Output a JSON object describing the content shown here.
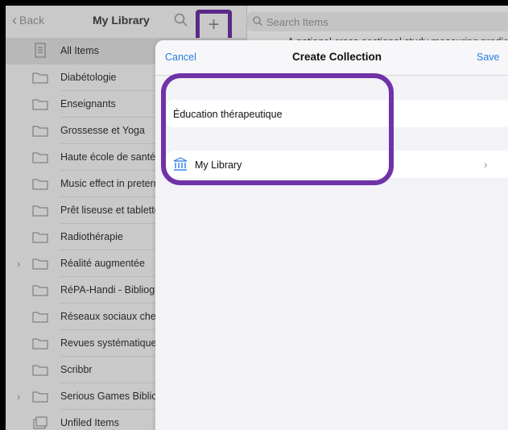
{
  "sidebar": {
    "back_label": "Back",
    "title": "My Library",
    "items": [
      {
        "label": "All Items",
        "icon": "document-icon",
        "selected": true,
        "expandable": false
      },
      {
        "label": "Diabétologie",
        "icon": "folder-icon",
        "selected": false,
        "expandable": false
      },
      {
        "label": "Enseignants",
        "icon": "folder-icon",
        "selected": false,
        "expandable": false
      },
      {
        "label": "Grossesse et Yoga",
        "icon": "folder-icon",
        "selected": false,
        "expandable": false
      },
      {
        "label": "Haute école de santé",
        "icon": "folder-icon",
        "selected": false,
        "expandable": false
      },
      {
        "label": "Music effect in preterm",
        "icon": "folder-icon",
        "selected": false,
        "expandable": false
      },
      {
        "label": "Prêt liseuse et tablette",
        "icon": "folder-icon",
        "selected": false,
        "expandable": false
      },
      {
        "label": "Radiothérapie",
        "icon": "folder-icon",
        "selected": false,
        "expandable": false
      },
      {
        "label": "Réalité augmentée",
        "icon": "folder-icon",
        "selected": false,
        "expandable": true
      },
      {
        "label": "RéPA-Handi - Bibliographie",
        "icon": "folder-icon",
        "selected": false,
        "expandable": false
      },
      {
        "label": "Réseaux sociaux chercheurs",
        "icon": "folder-icon",
        "selected": false,
        "expandable": false
      },
      {
        "label": "Revues systématiques",
        "icon": "folder-icon",
        "selected": false,
        "expandable": false
      },
      {
        "label": "Scribbr",
        "icon": "folder-icon",
        "selected": false,
        "expandable": false
      },
      {
        "label": "Serious Games Bibliothèque",
        "icon": "folder-icon",
        "selected": false,
        "expandable": true
      },
      {
        "label": "Unfiled Items",
        "icon": "unfiled-icon",
        "selected": false,
        "expandable": false
      }
    ]
  },
  "items_pane": {
    "search_placeholder": "Search Items",
    "first_item": "A national cross-sectional study measuring predictors"
  },
  "modal": {
    "cancel_label": "Cancel",
    "title": "Create Collection",
    "save_label": "Save",
    "name_value": "Éducation thérapeutique",
    "parent_label": "My Library"
  },
  "colors": {
    "accent": "#2a7be4",
    "highlight": "#6f32a8"
  }
}
